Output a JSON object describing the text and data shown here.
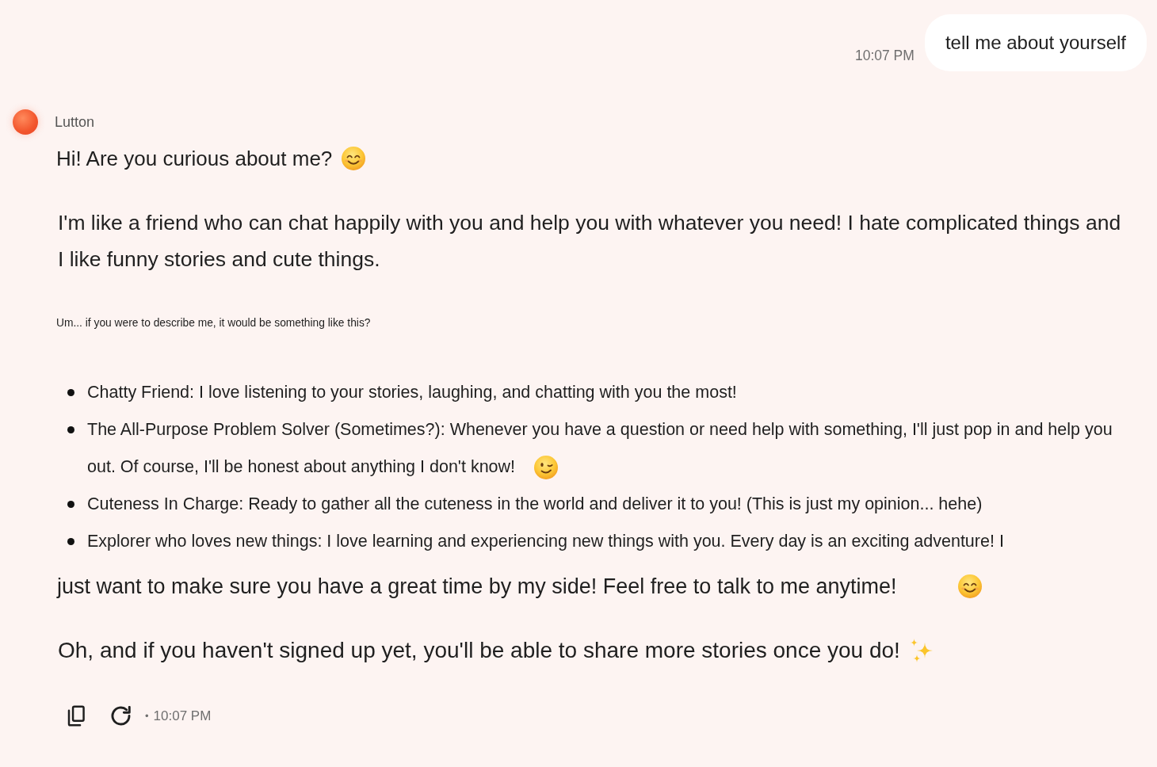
{
  "conversation": {
    "user_message": {
      "text": "tell me about yourself",
      "time": "10:07 PM"
    },
    "reply": {
      "sender": "Lutton",
      "blocks": [
        {
          "kind": "lead",
          "text": "Hi! Are you curious about me?"
        },
        {
          "kind": "paragraph",
          "text": "I'm like a friend who can chat happily with you and help you with whatever you need! I hate complicated things and I like funny stories and cute things."
        },
        {
          "kind": "note",
          "text": "Um... if you were to describe me, it would be something like this?"
        },
        {
          "kind": "list",
          "items": [
            {
              "lines": [
                "Chatty Friend: I love listening to your stories, laughing, and chatting with you the most!"
              ]
            },
            {
              "lines": [
                "The All-Purpose Problem Solver (Sometimes?): Whenever you have a question or need help with something, I'll just pop in and help you",
                "out. Of course, I'll be honest about anything I don't know!"
              ]
            },
            {
              "lines": [
                "Cuteness In Charge: Ready to gather all the cuteness in the world and deliver it to you! (This is just my opinion... hehe)"
              ]
            },
            {
              "lines": [
                "Explorer who loves new things: I love learning and experiencing new things with you. Every day is an exciting adventure! I"
              ]
            }
          ]
        },
        {
          "kind": "run_on",
          "text": "just want to make sure you have a great time by my side! Feel free to talk to me anytime!"
        },
        {
          "kind": "closing",
          "text": "Oh, and if you haven't signed up yet, you'll be able to share more stories once you do!"
        }
      ],
      "footer": {
        "separator": "•",
        "time": "10:07 PM"
      }
    }
  }
}
